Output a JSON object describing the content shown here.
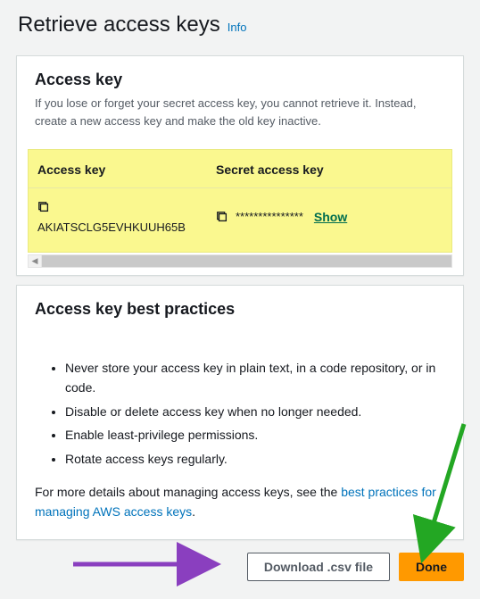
{
  "page": {
    "title": "Retrieve access keys",
    "info_label": "Info"
  },
  "access_key_panel": {
    "title": "Access key",
    "description": "If you lose or forget your secret access key, you cannot retrieve it. Instead, create a new access key and make the old key inactive.",
    "col_access_key": "Access key",
    "col_secret": "Secret access key",
    "access_key_value": "AKIATSCLG5EVHKUUH65B",
    "secret_value": "***************",
    "show_label": "Show"
  },
  "best_practices": {
    "title": "Access key best practices",
    "items": [
      "Never store your access key in plain text, in a code repository, or in code.",
      "Disable or delete access key when no longer needed.",
      "Enable least-privilege permissions.",
      "Rotate access keys regularly."
    ],
    "details_prefix": "For more details about managing access keys, see the ",
    "details_link": "best practices for managing AWS access keys",
    "details_suffix": "."
  },
  "footer": {
    "download_label": "Download .csv file",
    "done_label": "Done"
  }
}
